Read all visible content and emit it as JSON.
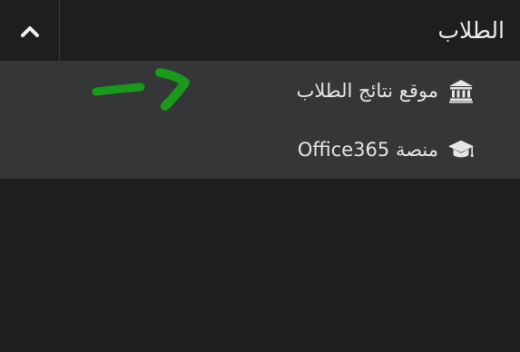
{
  "header": {
    "title": "الطلاب",
    "toggle_icon": "chevron-up-icon"
  },
  "menu": {
    "items": [
      {
        "label": "موقع نتائج الطلاب",
        "icon": "university-icon"
      },
      {
        "label": "منصة Office365",
        "icon": "graduation-cap-icon"
      }
    ]
  },
  "annotation": {
    "type": "hand-drawn-arrow",
    "color": "#1a9a1a"
  },
  "colors": {
    "background": "#1d1e20",
    "menu_background": "#353638",
    "text": "#e6e6e6"
  }
}
